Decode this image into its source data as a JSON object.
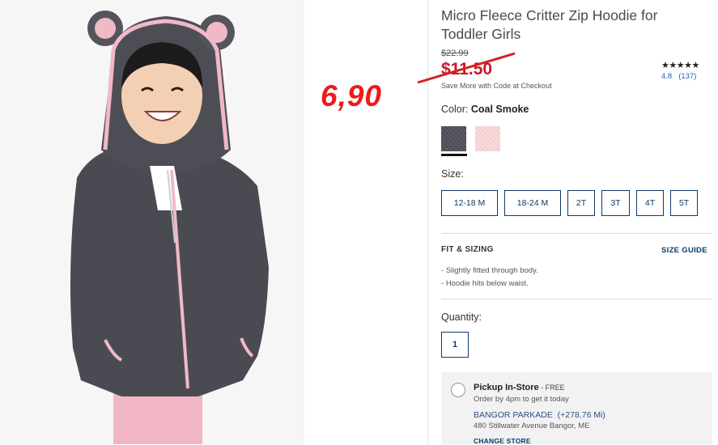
{
  "product": {
    "title": "Micro Fleece Critter Zip Hoodie for Toddler Girls",
    "original_price": "$22.99",
    "sale_price": "$11.50",
    "overlay_price": "6,90",
    "promo_note": "Save More with Code at Checkout",
    "stars": "★★★★★",
    "rating": "4.8",
    "review_count": "(137)"
  },
  "color": {
    "label": "Color:",
    "selected": "Coal Smoke",
    "swatches": [
      "coal-smoke",
      "pink"
    ]
  },
  "size": {
    "label": "Size:",
    "options": [
      "12-18 M",
      "18-24 M",
      "2T",
      "3T",
      "4T",
      "5T"
    ]
  },
  "fit": {
    "title": "FIT & SIZING",
    "guide_link": "SIZE GUIDE",
    "bullets": [
      "Slightly fitted through body.",
      "Hoodie hits below waist."
    ]
  },
  "quantity": {
    "label": "Quantity:",
    "value": "1"
  },
  "pickup": {
    "title": "Pickup In-Store",
    "free_label": " - FREE",
    "order_note": "Order by 4pm to get it today",
    "store_name": "BANGOR PARKADE",
    "distance": "(+278.76 Mi)",
    "address": "480 Stillwater Avenue Bangor, ME",
    "change_store": "CHANGE STORE"
  },
  "colors": {
    "accent": "#0e3a68",
    "sale": "#c7192a",
    "overlay": "#ee1a1a"
  }
}
